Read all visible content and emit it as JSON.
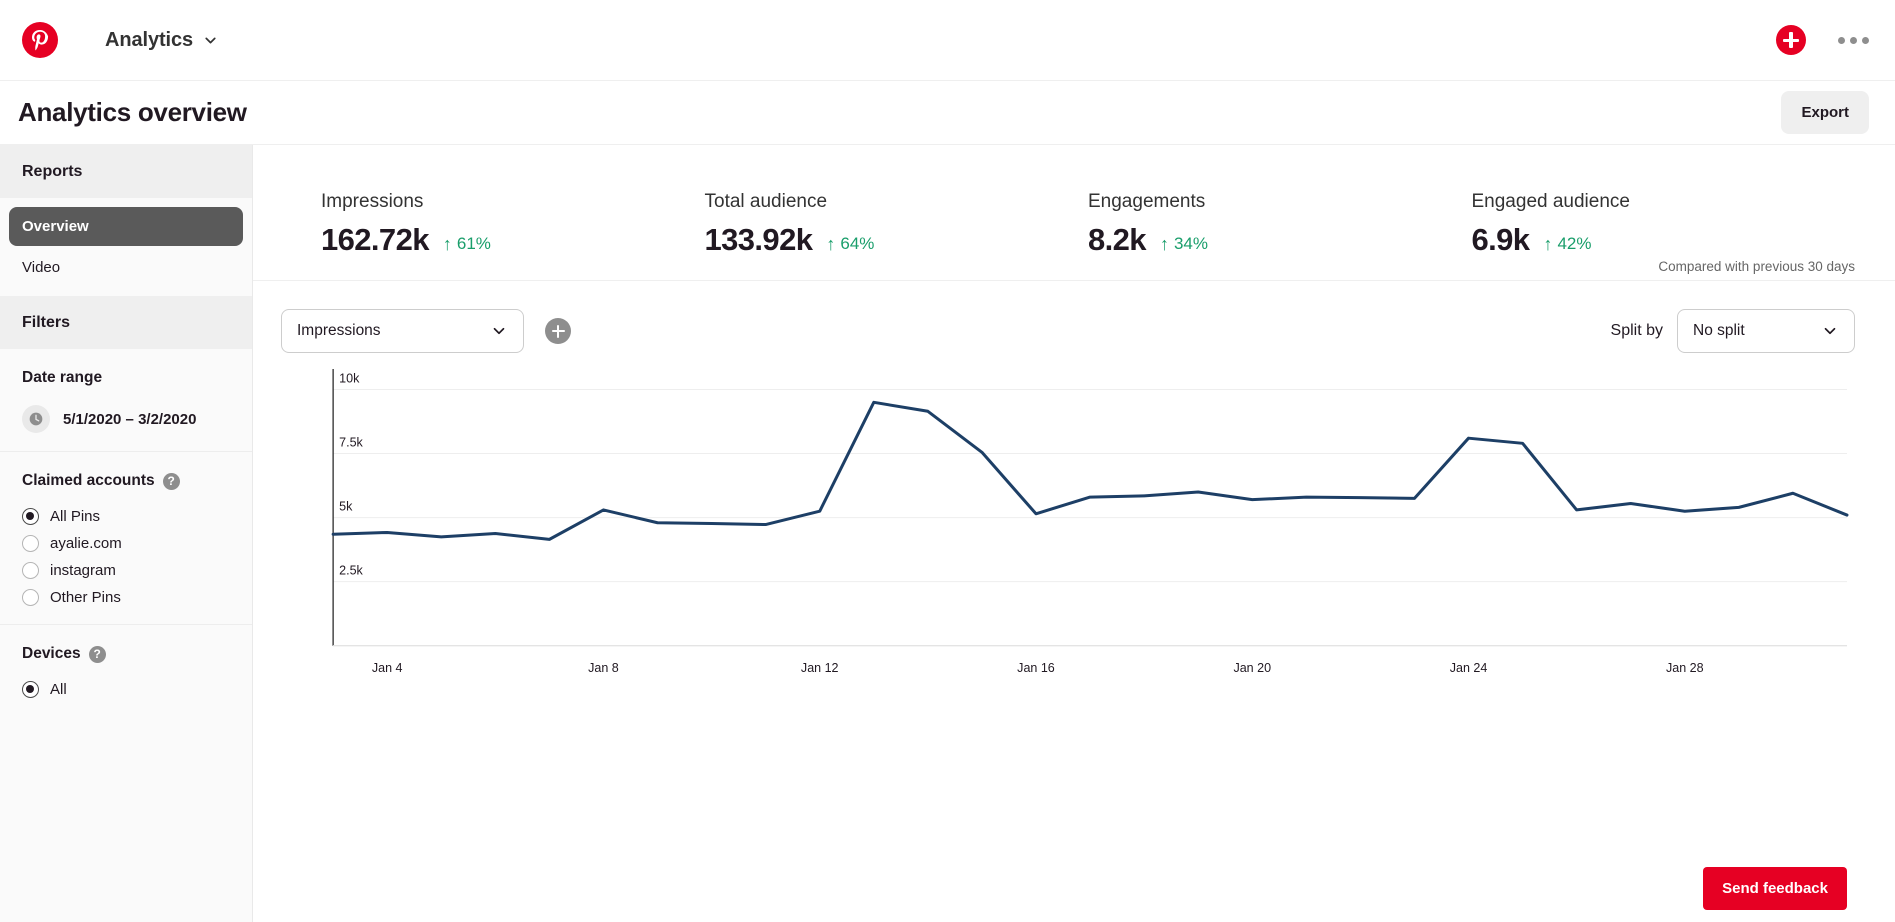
{
  "topnav": {
    "logo_icon": "pinterest-logo-icon",
    "section_label": "Analytics",
    "chevron_icon": "chevron-down-icon",
    "create_icon": "plus-icon",
    "more_icon": "more-horizontal-icon"
  },
  "titlebar": {
    "title": "Analytics overview",
    "export_label": "Export"
  },
  "sidebar": {
    "reports_header": "Reports",
    "reports_items": [
      {
        "label": "Overview",
        "active": true
      },
      {
        "label": "Video",
        "active": false
      }
    ],
    "filters_header": "Filters",
    "date_range": {
      "title": "Date range",
      "icon": "clock-icon",
      "value": "5/1/2020 – 3/2/2020"
    },
    "claimed_accounts": {
      "title": "Claimed accounts",
      "help_icon": "question-mark-icon",
      "help_glyph": "?",
      "options": [
        {
          "label": "All Pins",
          "checked": true
        },
        {
          "label": "ayalie.com",
          "checked": false
        },
        {
          "label": "instagram",
          "checked": false
        },
        {
          "label": "Other Pins",
          "checked": false
        }
      ]
    },
    "devices": {
      "title": "Devices",
      "help_icon": "question-mark-icon",
      "help_glyph": "?",
      "options": [
        {
          "label": "All",
          "checked": true
        }
      ]
    }
  },
  "metrics": {
    "items": [
      {
        "label": "Impressions",
        "value": "162.72k",
        "delta": "61%",
        "arrow": "↑"
      },
      {
        "label": "Total audience",
        "value": "133.92k",
        "delta": "64%",
        "arrow": "↑"
      },
      {
        "label": "Engagements",
        "value": "8.2k",
        "delta": "34%",
        "arrow": "↑"
      },
      {
        "label": "Engaged audience",
        "value": "6.9k",
        "delta": "42%",
        "arrow": "↑"
      }
    ],
    "comparison_note": "Compared with previous 30 days",
    "delta_color": "#1a9e6b"
  },
  "chart_controls": {
    "metric_select": {
      "value": "Impressions",
      "chevron_icon": "chevron-down-icon"
    },
    "add_metric_icon": "plus-icon",
    "split_by_label": "Split by",
    "split_select": {
      "value": "No split",
      "chevron_icon": "chevron-down-icon"
    }
  },
  "feedback": {
    "label": "Send feedback"
  },
  "chart_data": {
    "type": "line",
    "title": "Impressions",
    "xlabel": "",
    "ylabel": "",
    "grid": true,
    "legend": false,
    "line_color": "#1d3f66",
    "ylim": [
      0,
      10800
    ],
    "yticks": [
      2500,
      5000,
      7500,
      10000
    ],
    "ytick_labels": [
      "2.5k",
      "5k",
      "7.5k",
      "10k"
    ],
    "xtick_labels": [
      "Jan 4",
      "Jan 8",
      "Jan 12",
      "Jan 16",
      "Jan 20",
      "Jan 24",
      "Jan 28"
    ],
    "xtick_indices": [
      1,
      5,
      9,
      13,
      17,
      21,
      25
    ],
    "x": [
      "Jan 3",
      "Jan 4",
      "Jan 5",
      "Jan 6",
      "Jan 7",
      "Jan 8",
      "Jan 9",
      "Jan 10",
      "Jan 11",
      "Jan 12",
      "Jan 13",
      "Jan 14",
      "Jan 15",
      "Jan 16",
      "Jan 17",
      "Jan 18",
      "Jan 19",
      "Jan 20",
      "Jan 21",
      "Jan 22",
      "Jan 23",
      "Jan 24",
      "Jan 25",
      "Jan 26",
      "Jan 27",
      "Jan 28",
      "Jan 29",
      "Jan 30"
    ],
    "values": [
      4350,
      4420,
      4250,
      4380,
      4150,
      5300,
      4800,
      4770,
      4730,
      5250,
      9500,
      9150,
      7550,
      5150,
      5800,
      5850,
      6000,
      5700,
      5800,
      5780,
      5750,
      8100,
      7900,
      5300,
      5550,
      5250,
      5400,
      5950
    ],
    "last_value": 5100
  }
}
